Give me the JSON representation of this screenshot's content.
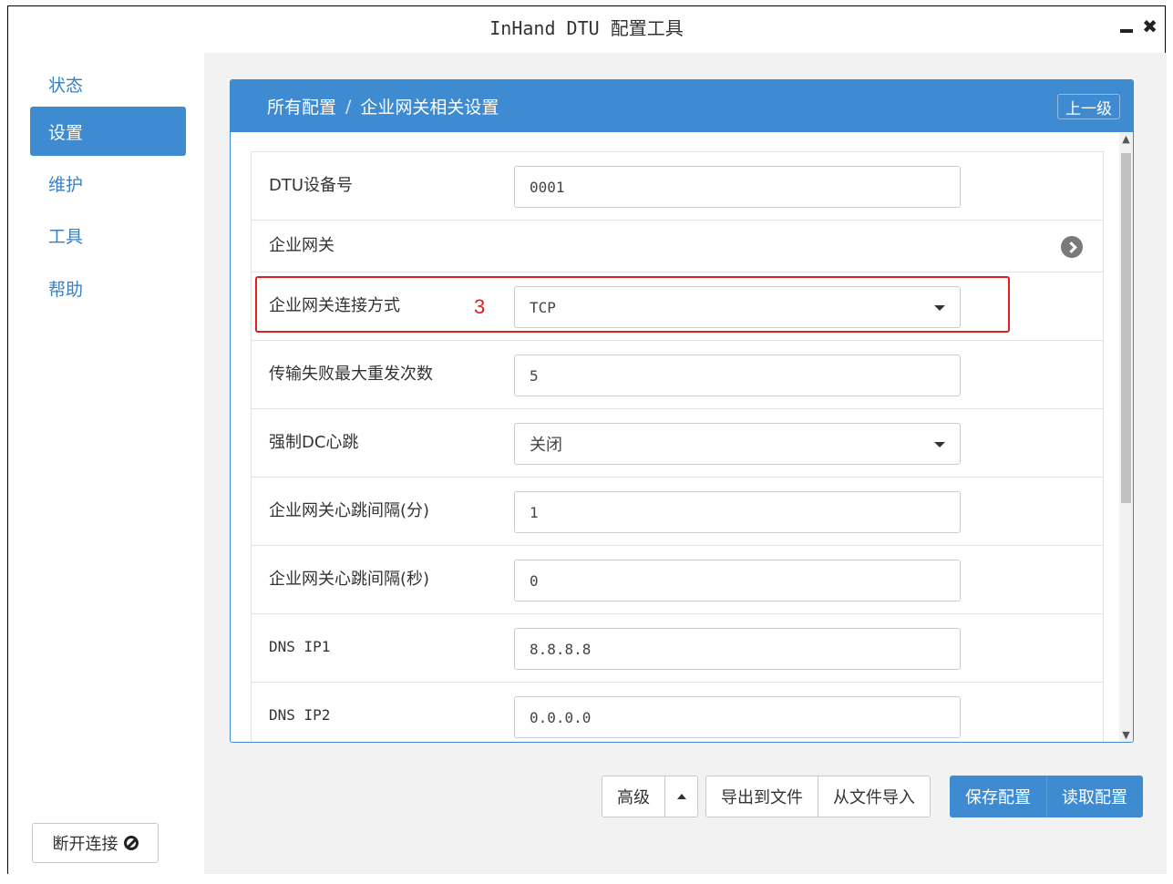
{
  "window": {
    "title": "InHand DTU 配置工具",
    "minimize_icon": "minimize-icon",
    "close_label": "✖"
  },
  "sidebar": {
    "items": [
      {
        "label": "状态",
        "active": false
      },
      {
        "label": "设置",
        "active": true
      },
      {
        "label": "维护",
        "active": false
      },
      {
        "label": "工具",
        "active": false
      },
      {
        "label": "帮助",
        "active": false
      }
    ],
    "disconnect_label": "断开连接"
  },
  "panel": {
    "breadcrumb_root": "所有配置",
    "breadcrumb_sep": "/",
    "breadcrumb_current": "企业网关相关设置",
    "up_label": "上一级"
  },
  "form": {
    "rows": [
      {
        "label": "DTU设备号",
        "value": "0001",
        "type": "input"
      },
      {
        "label": "企业网关",
        "type": "section"
      },
      {
        "label": "企业网关连接方式",
        "value": "TCP",
        "type": "select",
        "annotation": "3"
      },
      {
        "label": "传输失败最大重发次数",
        "value": "5",
        "type": "input"
      },
      {
        "label": "强制DC心跳",
        "value": "关闭",
        "type": "select"
      },
      {
        "label": "企业网关心跳间隔(分)",
        "value": "1",
        "type": "input"
      },
      {
        "label": "企业网关心跳间隔(秒)",
        "value": "0",
        "type": "input"
      },
      {
        "label": "DNS IP1",
        "value": "8.8.8.8",
        "type": "input"
      },
      {
        "label": "DNS IP2",
        "value": "0.0.0.0",
        "type": "input"
      }
    ]
  },
  "footer": {
    "advanced_label": "高级",
    "export_label": "导出到文件",
    "import_label": "从文件导入",
    "save_label": "保存配置",
    "read_label": "读取配置"
  },
  "colors": {
    "accent": "#3e8bd1",
    "highlight": "#e02020"
  }
}
